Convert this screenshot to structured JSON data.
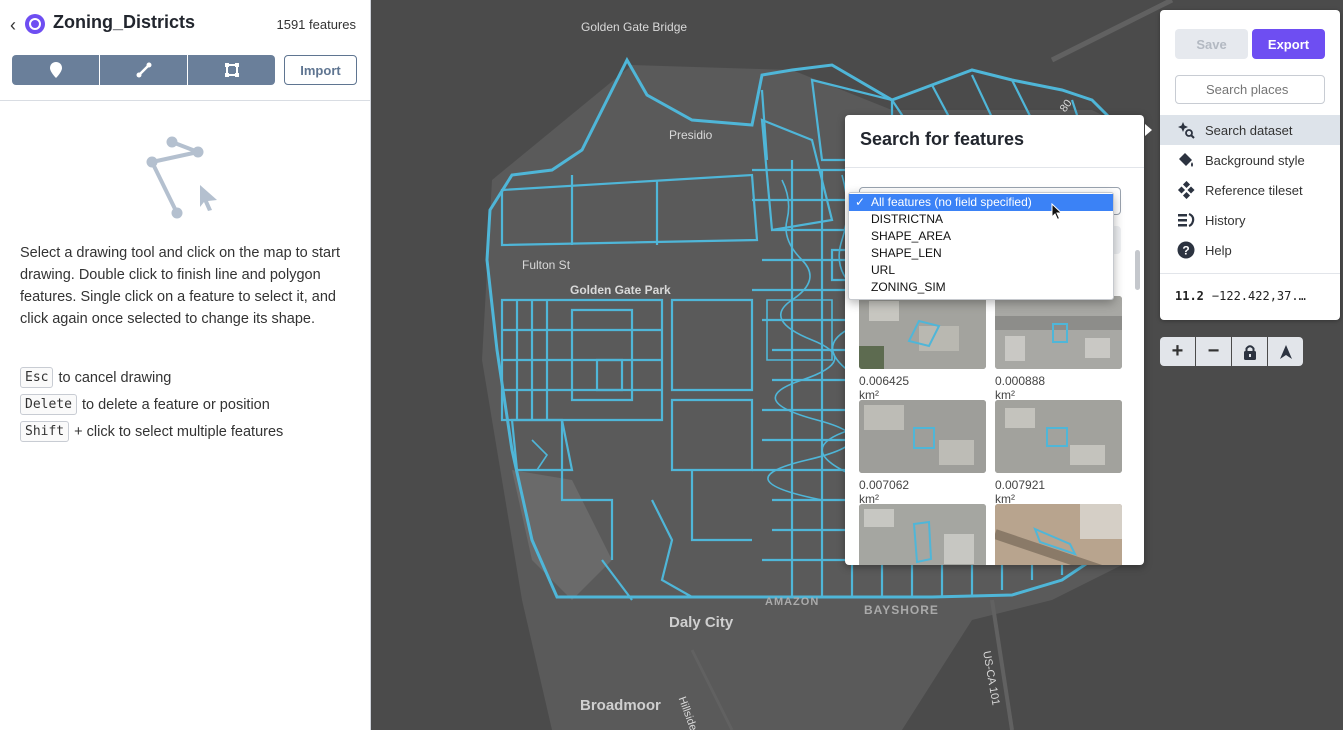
{
  "header": {
    "dataset_title": "Zoning_Districts",
    "feature_count": "1591 features",
    "import_label": "Import"
  },
  "instructions": {
    "text": "Select a drawing tool and click on the map to start drawing. Double click to finish line and polygon features. Single click on a feature to select it, and click again once selected to change its shape.",
    "shortcuts": [
      {
        "key": "Esc",
        "desc": "to cancel drawing"
      },
      {
        "key": "Delete",
        "desc": "to delete a feature or position"
      },
      {
        "key": "Shift",
        "desc": "+ click to select multiple features"
      }
    ]
  },
  "map": {
    "labels": [
      {
        "text": "Golden Gate Bridge"
      },
      {
        "text": "Presidio"
      },
      {
        "text": "Fulton St"
      },
      {
        "text": "Golden Gate Park"
      },
      {
        "text": "Daly City"
      },
      {
        "text": "BAYSHORE"
      },
      {
        "text": "Broadmoor"
      },
      {
        "text": "Hillside Blvd"
      },
      {
        "text": "US-CA 101"
      },
      {
        "text": "80"
      },
      {
        "text": "AMAZON"
      }
    ]
  },
  "search_popup": {
    "title": "Search for features",
    "field_options": [
      "All features (no field specified)",
      "DISTRICTNA",
      "SHAPE_AREA",
      "SHAPE_LEN",
      "URL",
      "ZONING_SIM"
    ],
    "selected_option": "All features (no field specified)",
    "results": [
      {
        "area": "0.006425 km²"
      },
      {
        "area": "0.000888 km²"
      },
      {
        "area": "0.007062 km²"
      },
      {
        "area": "0.007921 km²"
      },
      {
        "area": ""
      },
      {
        "area": ""
      }
    ]
  },
  "toolbar": {
    "save_label": "Save",
    "export_label": "Export",
    "search_places_placeholder": "Search places"
  },
  "side_menu": {
    "items": [
      {
        "label": "Search dataset",
        "icon": "search-dataset-icon",
        "active": true
      },
      {
        "label": "Background style",
        "icon": "paint-bucket-icon",
        "active": false
      },
      {
        "label": "Reference tileset",
        "icon": "tileset-icon",
        "active": false
      },
      {
        "label": "History",
        "icon": "history-icon",
        "active": false
      },
      {
        "label": "Help",
        "icon": "help-icon",
        "active": false
      }
    ]
  },
  "status": {
    "zoom": "11.2",
    "coordinates": "−122.422,37.…"
  },
  "colors": {
    "accent": "#6e4ef2",
    "feature_stroke": "#4fb6d8",
    "tool_button": "#6a7f9a"
  }
}
